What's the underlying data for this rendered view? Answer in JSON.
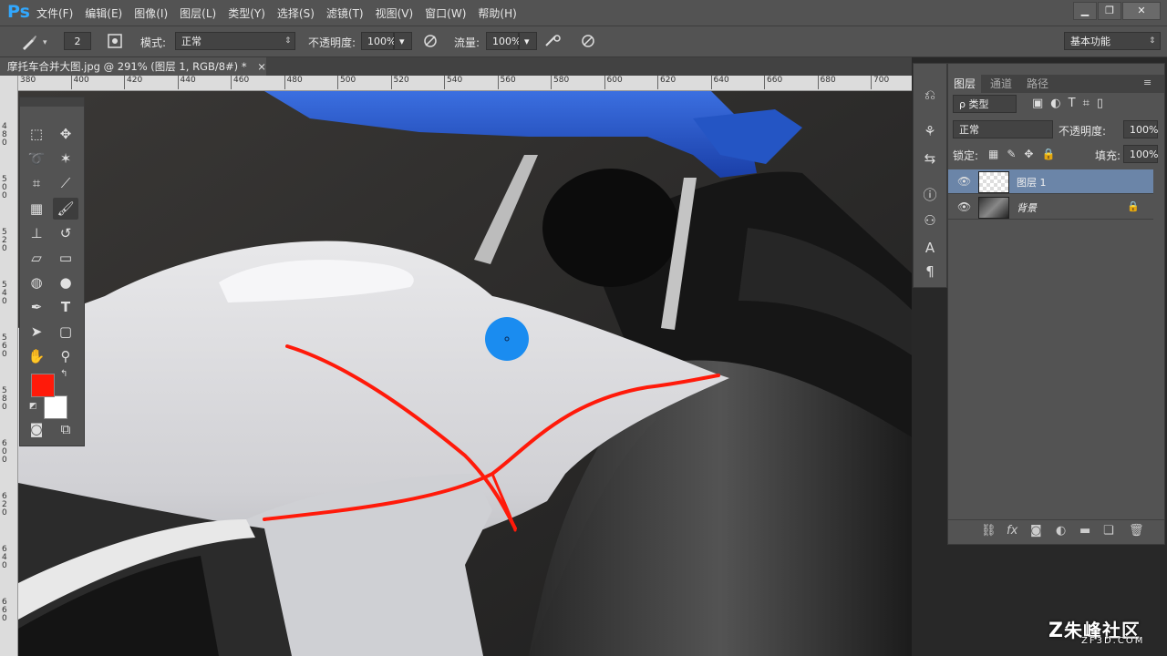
{
  "app": {
    "logo": "Ps"
  },
  "menu": [
    "文件(F)",
    "编辑(E)",
    "图像(I)",
    "图层(L)",
    "类型(Y)",
    "选择(S)",
    "滤镜(T)",
    "视图(V)",
    "窗口(W)",
    "帮助(H)"
  ],
  "window_controls": {
    "minimize": "▁",
    "restore": "❐",
    "close": "✕"
  },
  "options": {
    "brush_size": "2",
    "mode_label": "模式:",
    "mode_value": "正常",
    "opacity_label": "不透明度:",
    "opacity_value": "100%",
    "flow_label": "流量:",
    "flow_value": "100%",
    "workspace": "基本功能"
  },
  "document": {
    "tab_title": "摩托车合并大图.jpg @ 291% (图层 1, RGB/8#) *",
    "tab_close": "×"
  },
  "ruler": {
    "h_ticks": [
      "380",
      "400",
      "420",
      "440",
      "460",
      "480",
      "500",
      "520",
      "540",
      "560",
      "580",
      "600",
      "620",
      "640",
      "660",
      "680",
      "700"
    ],
    "v_ticks": [
      "480",
      "500",
      "520",
      "540",
      "560",
      "580",
      "600",
      "620",
      "640",
      "660"
    ]
  },
  "colors": {
    "foreground": "#ff1a0a",
    "background": "#ffffff",
    "brush_cursor": "#1a8cf0"
  },
  "layers_panel": {
    "tabs": [
      "图层",
      "通道",
      "路径"
    ],
    "filter_label": "ρ 类型",
    "blend_mode": "正常",
    "opacity_label": "不透明度:",
    "opacity_value": "100%",
    "lock_label": "锁定:",
    "fill_label": "填充:",
    "fill_value": "100%",
    "layers": [
      {
        "name": "图层 1",
        "selected": true,
        "locked": false
      },
      {
        "name": "背景",
        "selected": false,
        "locked": true
      }
    ],
    "bottom_icons": [
      "link-icon",
      "fx-icon",
      "mask-icon",
      "adjustment-icon",
      "group-icon",
      "new-layer-icon",
      "trash-icon"
    ]
  },
  "watermark": {
    "brand": "朱峰社区",
    "url": "ZF3D.COM"
  }
}
